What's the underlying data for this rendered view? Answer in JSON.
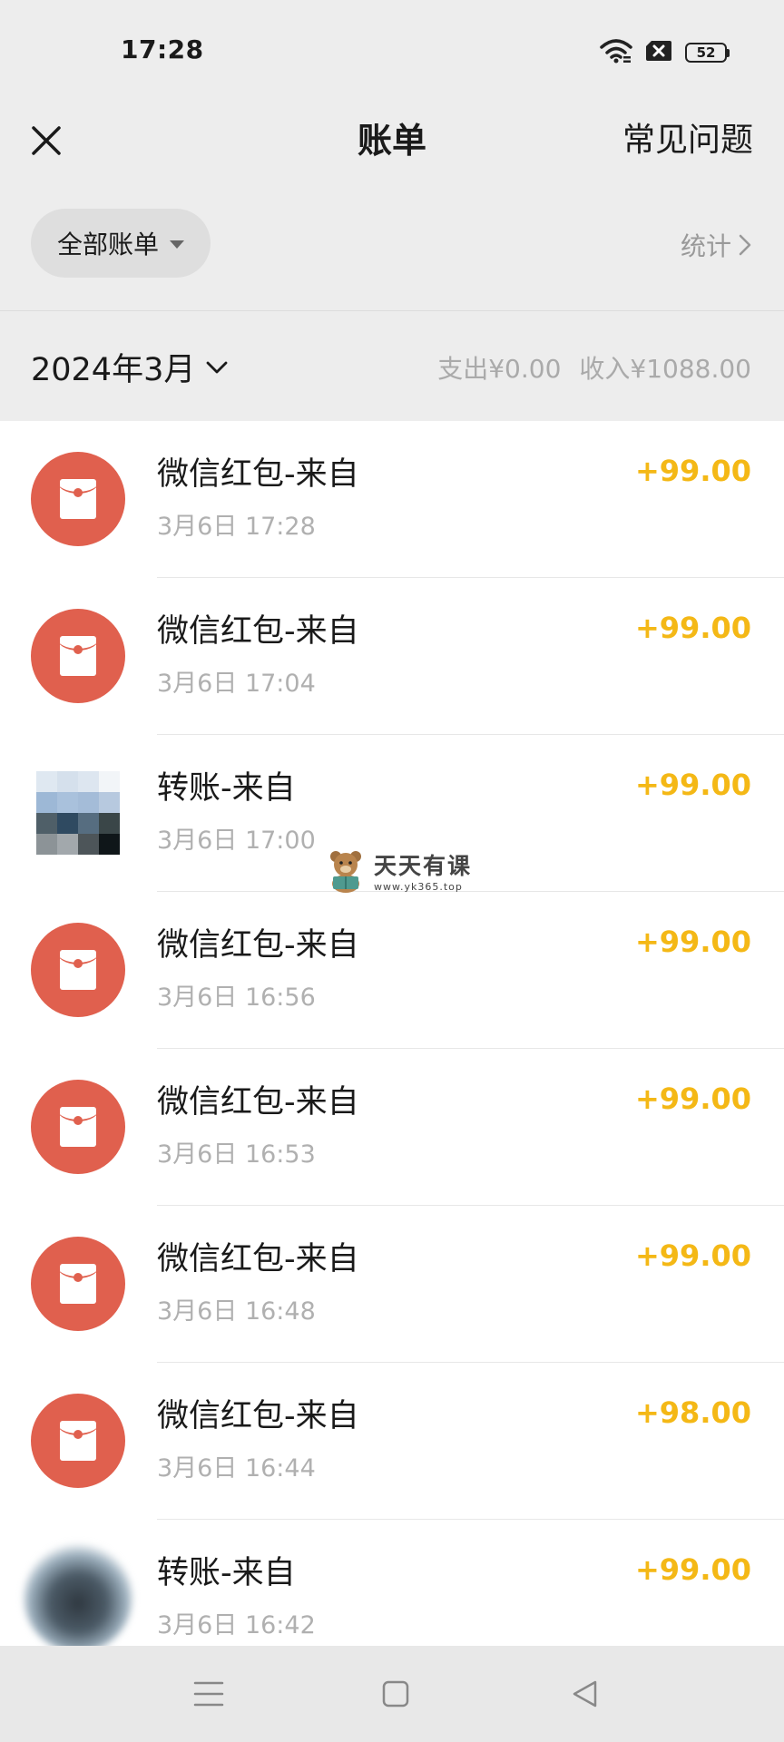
{
  "status_bar": {
    "time": "17:28",
    "battery": "52"
  },
  "header": {
    "title": "账单",
    "faq": "常见问题"
  },
  "filter": {
    "label": "全部账单",
    "stats": "统计"
  },
  "month": {
    "label": "2024年3月",
    "expense": "支出¥0.00",
    "income": "收入¥1088.00"
  },
  "transactions": [
    {
      "title": "微信红包-来自",
      "time": "3月6日 17:28",
      "amount": "+99.00",
      "icon": "red-packet-icon"
    },
    {
      "title": "微信红包-来自",
      "time": "3月6日 17:04",
      "amount": "+99.00",
      "icon": "red-packet-icon"
    },
    {
      "title": "转账-来自",
      "time": "3月6日 17:00",
      "amount": "+99.00",
      "icon": "pixelated-avatar"
    },
    {
      "title": "微信红包-来自",
      "time": "3月6日 16:56",
      "amount": "+99.00",
      "icon": "red-packet-icon"
    },
    {
      "title": "微信红包-来自",
      "time": "3月6日 16:53",
      "amount": "+99.00",
      "icon": "red-packet-icon"
    },
    {
      "title": "微信红包-来自",
      "time": "3月6日 16:48",
      "amount": "+99.00",
      "icon": "red-packet-icon"
    },
    {
      "title": "微信红包-来自",
      "time": "3月6日 16:44",
      "amount": "+98.00",
      "icon": "red-packet-icon"
    },
    {
      "title": "转账-来自",
      "time": "3月6日 16:42",
      "amount": "+99.00",
      "icon": "blurred-avatar"
    }
  ],
  "watermark": {
    "title": "天天有课",
    "url": "www.yk365.top"
  },
  "colors": {
    "amount": "#f4b816",
    "red_packet": "#e0604e",
    "background": "#ededed"
  }
}
